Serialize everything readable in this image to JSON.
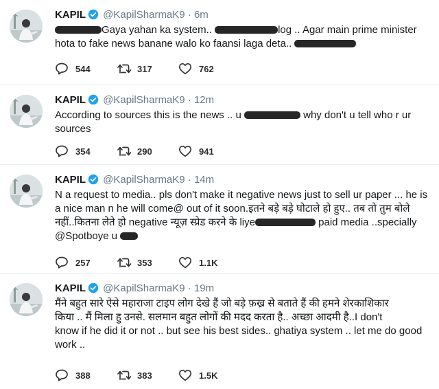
{
  "tweets": [
    {
      "name": "KAPIL",
      "handle": "@KapilSharmaK9",
      "separator": "·",
      "time": "6m",
      "lines": [
        [
          "",
          "R:68",
          "Gaya yahan ka system.. ",
          "R:92",
          "log .. Agar main prime minister"
        ],
        [
          "hota to fake news banane walo ko faansi laga deta.. ",
          "R:90"
        ]
      ],
      "replies": "544",
      "retweets": "317",
      "likes": "762"
    },
    {
      "name": "KAPIL",
      "handle": "@KapilSharmaK9",
      "separator": "·",
      "time": "12m",
      "lines": [
        [
          "According to sources this is the news .. u ",
          "R:82",
          " why don't u tell who r ur"
        ],
        [
          "sources"
        ]
      ],
      "replies": "354",
      "retweets": "290",
      "likes": "941"
    },
    {
      "name": "KAPIL",
      "handle": "@KapilSharmaK9",
      "separator": "·",
      "time": "14m",
      "lines": [
        [
          "N a request to media.. pls don't make it negative news just to sell ur paper ... he is"
        ],
        [
          "a nice man n he will come@ out of it soon.इतने बड़े बड़े घोटाले हो हुए.. तब तो तुम बोले"
        ],
        [
          "नहीं..कितना लेते हो negative न्यूज़ स्प्रेड करने के liye",
          "R:88",
          " paid media ..specially"
        ],
        [
          "@Spotboye u ",
          "R:26"
        ]
      ],
      "replies": "257",
      "retweets": "353",
      "likes": "1.1K"
    },
    {
      "name": "KAPIL",
      "handle": "@KapilSharmaK9",
      "separator": "·",
      "time": "19m",
      "lines": [
        [
          "मैंने बहुत सारे ऐसे महाराजा टाइप लोग देखे हैं जो बड़े फ़ख्र से बताते हैं की हमने शेरकाशिकार"
        ],
        [
          "किया .. मैं मिला हु  उनसे. सलमान बहुत लोगों की मदद करता है.. अच्छा आदमी है..I don't"
        ],
        [
          "know if he did it or not .. but see his best sides.. ghatiya system .. let me do good"
        ],
        [
          "work .."
        ]
      ],
      "replies": "388",
      "retweets": "383",
      "likes": "1.5K"
    }
  ],
  "colors": {
    "verified": "#1da1f2",
    "muted": "#657786",
    "redaction": "#262626"
  },
  "icons": {
    "reply": "reply-icon",
    "retweet": "retweet-icon",
    "like": "heart-icon",
    "verified": "verified-badge-icon"
  }
}
